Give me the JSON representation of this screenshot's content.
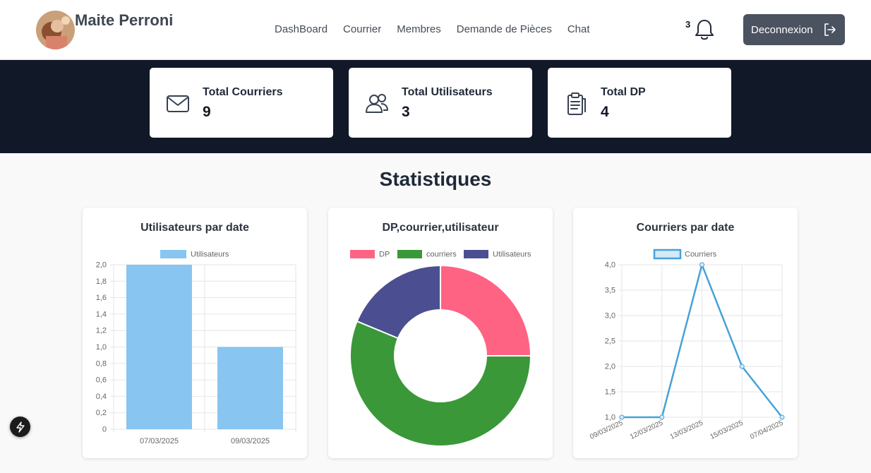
{
  "header": {
    "user_name": "Maite Perroni",
    "nav": [
      "DashBoard",
      "Courrier",
      "Membres",
      "Demande de Pièces",
      "Chat"
    ],
    "notification_count": "3",
    "logout_label": "Deconnexion"
  },
  "stats": [
    {
      "label": "Total Courriers",
      "value": "9",
      "icon": "mail-icon"
    },
    {
      "label": "Total Utilisateurs",
      "value": "3",
      "icon": "users-icon"
    },
    {
      "label": "Total DP",
      "value": "4",
      "icon": "clipboard-icon"
    }
  ],
  "section_title": "Statistiques",
  "charts": {
    "users_title": "Utilisateurs par date",
    "donut_title": "DP,courrier,utilisateur",
    "mail_title": "Courriers par date"
  },
  "colors": {
    "dark": "#111827",
    "bar_blue": "#88c5f0",
    "pink": "#ff6384",
    "green": "#3a9838",
    "navy": "#4b4f91",
    "line_blue": "#46a2d8"
  },
  "chart_data": [
    {
      "type": "bar",
      "title": "Utilisateurs par date",
      "categories": [
        "07/03/2025",
        "09/03/2025"
      ],
      "series": [
        {
          "name": "Utilisateurs",
          "values": [
            2,
            1
          ]
        }
      ],
      "ylim": [
        0,
        2
      ],
      "yticks": [
        "2,0",
        "1,8",
        "1,6",
        "1,4",
        "1,2",
        "1,0",
        "0,8",
        "0,6",
        "0,4",
        "0,2",
        "0"
      ],
      "legend": "top",
      "grid": true
    },
    {
      "type": "pie",
      "title": "DP,courrier,utilisateur",
      "labels": [
        "DP",
        "courriers",
        "Utilisateurs"
      ],
      "values": [
        4,
        9,
        3
      ],
      "legend": "top"
    },
    {
      "type": "line",
      "title": "Courriers par date",
      "x": [
        "09/03/2025",
        "12/03/2025",
        "13/03/2025",
        "15/03/2025",
        "07/04/2025"
      ],
      "series": [
        {
          "name": "Courriers",
          "values": [
            1,
            1,
            4,
            2,
            1
          ]
        }
      ],
      "ylim": [
        1,
        4
      ],
      "yticks": [
        "4,0",
        "3,5",
        "3,0",
        "2,5",
        "2,0",
        "1,5",
        "1,0"
      ],
      "legend": "top",
      "grid": true
    }
  ]
}
